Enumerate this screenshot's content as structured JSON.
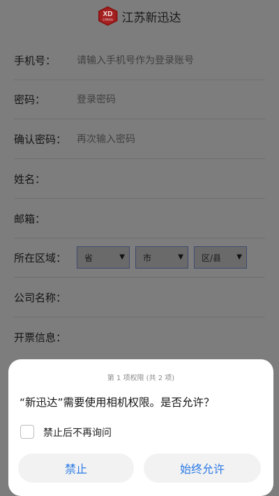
{
  "header": {
    "logo_text": "XD",
    "logo_sub": "江苏新迅达",
    "brand_name": "江苏新迅达"
  },
  "form": {
    "phone": {
      "label": "手机号：",
      "placeholder": "请输入手机号作为登录账号"
    },
    "password": {
      "label": "密码：",
      "placeholder": "登录密码"
    },
    "confirm_password": {
      "label": "确认密码：",
      "placeholder": "再次输入密码"
    },
    "name": {
      "label": "姓名："
    },
    "email": {
      "label": "邮箱："
    },
    "region": {
      "label": "所在区域：",
      "province": "省",
      "city": "市",
      "district": "区/县"
    },
    "company": {
      "label": "公司名称："
    },
    "invoice": {
      "label": "开票信息："
    }
  },
  "permission_dialog": {
    "counter": "第 1 项权限 (共 2 项)",
    "question": "“新迅达”需要使用相机权限。是否允许？",
    "dont_ask_label": "禁止后不再询问",
    "deny_label": "禁止",
    "allow_label": "始终允许"
  },
  "colors": {
    "accent": "#2c7be5",
    "dim_background": "#7d7d7d",
    "logo": "#a52020"
  }
}
